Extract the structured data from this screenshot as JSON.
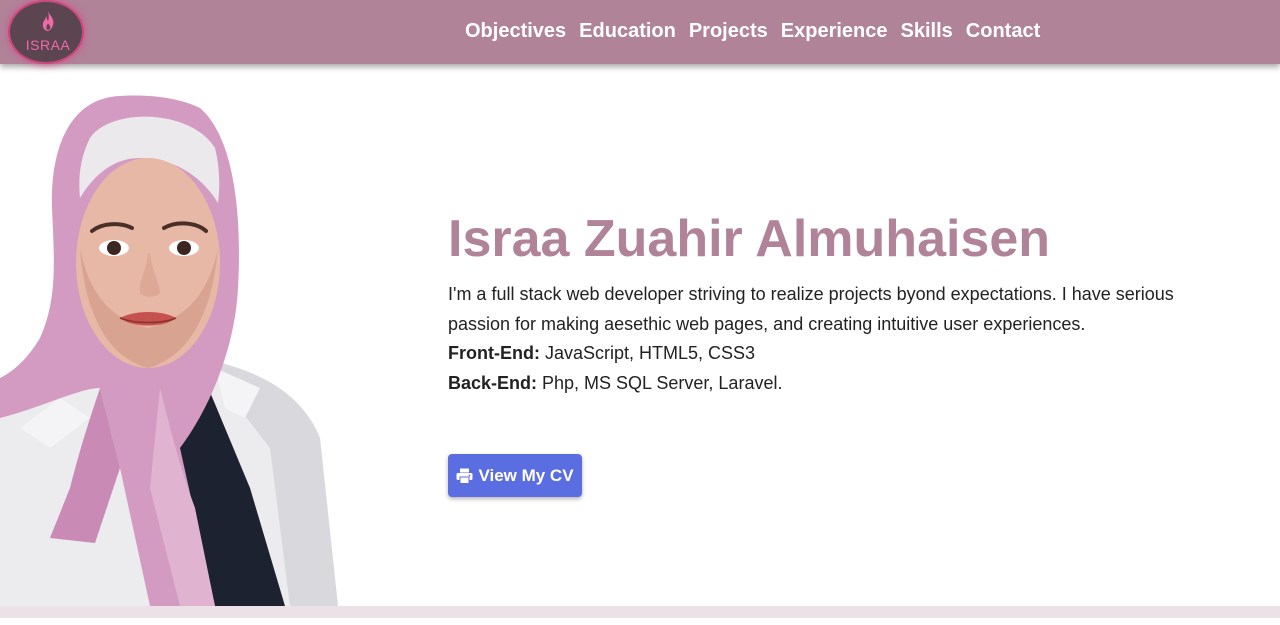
{
  "brand": {
    "logo_text": "ISRAA",
    "accent_color": "#b08399",
    "logo_glow_color": "#d94d8a"
  },
  "nav": {
    "items": [
      {
        "label": "Objectives"
      },
      {
        "label": "Education"
      },
      {
        "label": "Projects"
      },
      {
        "label": "Experience"
      },
      {
        "label": "Skills"
      },
      {
        "label": "Contact"
      }
    ]
  },
  "hero": {
    "name": "Israa Zuahir Almuhaisen",
    "description": "I'm a full stack web developer striving to realize projects byond expectations. I have serious passion for making aesethic web pages, and creating intuitive user experiences.",
    "front_end_label": "Front-End:",
    "front_end_value": " JavaScript, HTML5, CSS3",
    "back_end_label": "Back-End:",
    "back_end_value": " Php, MS SQL Server, Laravel.",
    "cv_button_label": "View My CV",
    "cv_button_icon": "printer-icon",
    "cv_button_color": "#5b6ee1"
  }
}
